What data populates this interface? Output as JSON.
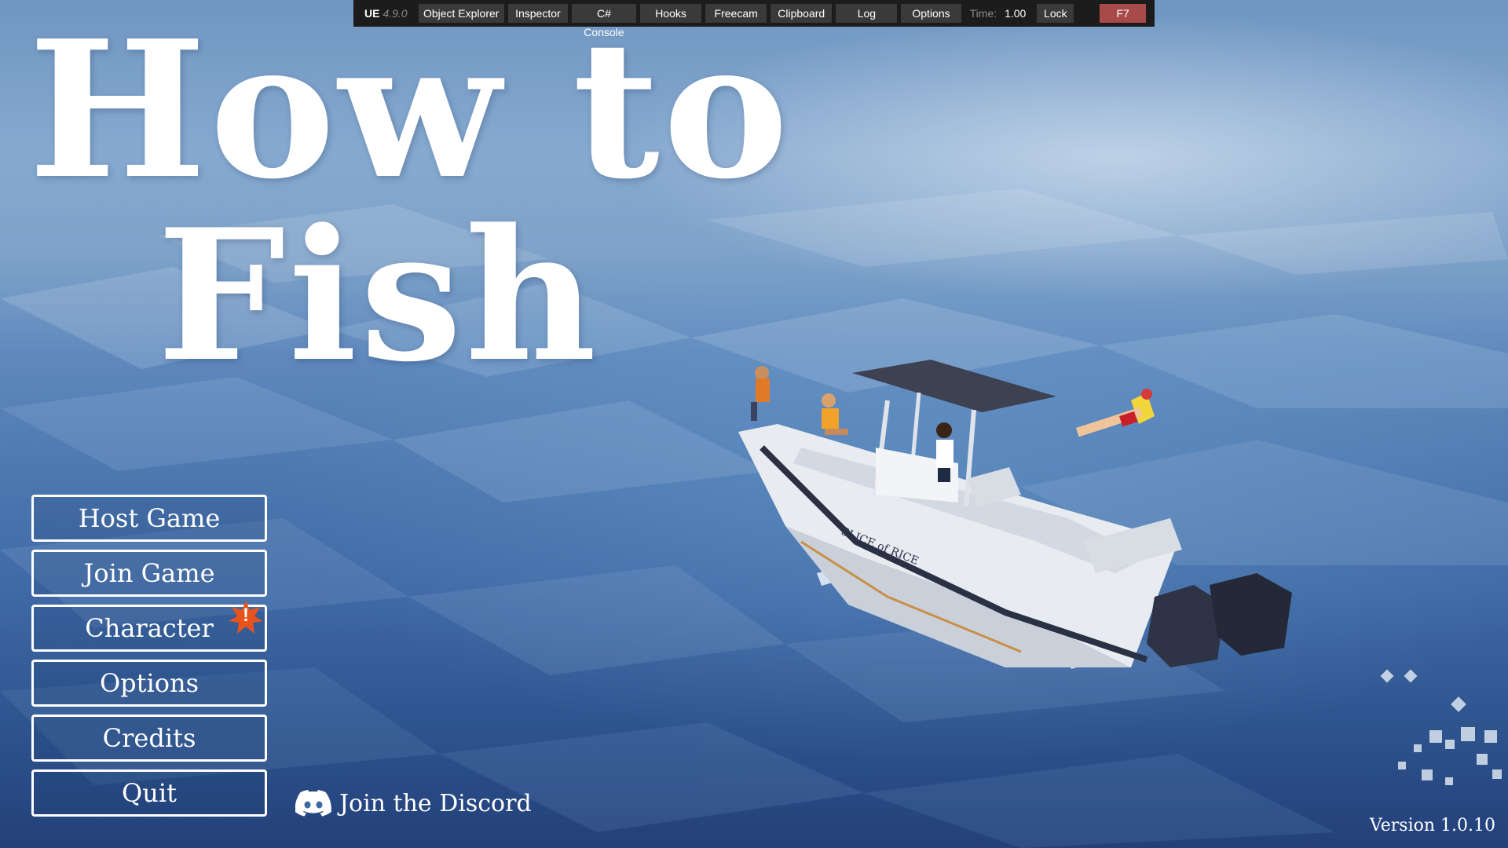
{
  "debug_bar": {
    "app_label": "UE",
    "version": "4.9.0",
    "buttons": [
      "Object Explorer",
      "Inspector",
      "C# Console",
      "Hooks",
      "Freecam",
      "Clipboard",
      "Log",
      "Options"
    ],
    "time_label": "Time:",
    "time_value": "1.00",
    "lock_label": "Lock",
    "toggle_key": "F7",
    "colors": {
      "bar_bg": "#1c1c1c",
      "button_bg": "#3a3a3a",
      "toggle_bg": "#a94a4a"
    }
  },
  "title": {
    "line1": "How to",
    "line2": "Fish"
  },
  "menu": {
    "items": [
      {
        "label": "Host Game"
      },
      {
        "label": "Join Game"
      },
      {
        "label": "Character",
        "alert": "!"
      },
      {
        "label": "Options"
      },
      {
        "label": "Credits"
      },
      {
        "label": "Quit"
      }
    ],
    "alert_color": "#e8541c"
  },
  "discord": {
    "label": "Join the Discord",
    "icon": "discord-icon"
  },
  "boat": {
    "hull_text": "SLICE of RICE"
  },
  "version": "Version 1.0.10"
}
